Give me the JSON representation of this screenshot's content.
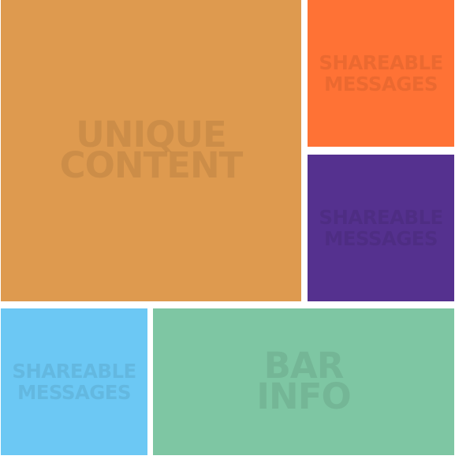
{
  "tiles": {
    "unique_content": {
      "label": "UNIQUE\nCONTENT",
      "color": "#DE9A4F"
    },
    "shareable_messages_orange": {
      "label": "SHAREABLE\nMESSAGES",
      "color": "#FF7235"
    },
    "shareable_messages_purple": {
      "label": "SHAREABLE\nMESSAGES",
      "color": "#55318F"
    },
    "shareable_messages_blue": {
      "label": "SHAREABLE\nMESSAGES",
      "color": "#6CC8F4"
    },
    "bar_info": {
      "label": "BAR\nINFO",
      "color": "#7EC6A3"
    }
  }
}
